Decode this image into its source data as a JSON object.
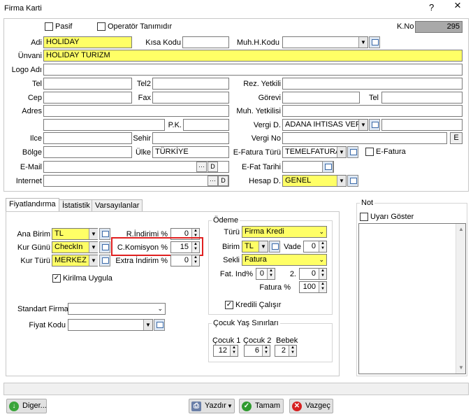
{
  "window": {
    "title": "Firma Karti",
    "help_icon": "?",
    "close_icon": "×"
  },
  "header": {
    "pasif": "Pasif",
    "operator": "Operatör Tanımıdır",
    "kno_label": "K.No",
    "kno_value": "295"
  },
  "fields": {
    "adi_label": "Adi",
    "adi_value": "HOLIDAY",
    "kisa_kodu_label": "Kısa Kodu",
    "muh_kodu_label": "Muh.H.Kodu",
    "unvani_label": "Ünvani",
    "unvani_value": "HOLIDAY TURIZM",
    "logo_label": "Logo Adı",
    "tel_label": "Tel",
    "tel2_label": "Tel2",
    "rez_yetkili_label": "Rez. Yetkili",
    "cep_label": "Cep",
    "fax_label": "Fax",
    "gorevi_label": "Görevi",
    "tel3_label": "Tel",
    "adres_label": "Adres",
    "muh_yetkilisi_label": "Muh. Yetkilisi",
    "pk_label": "P.K.",
    "vergi_d_label": "Vergi D.",
    "vergi_d_value": "ADANA IHTISAS VERG",
    "ilce_label": "Ilce",
    "sehir_label": "Sehir",
    "vergi_no_label": "Vergi No",
    "e_button": "E",
    "bolge_label": "Bölge",
    "ulke_label": "Ülke",
    "ulke_value": "TÜRKİYE",
    "efatura_turu_label": "E-Fatura Türü",
    "efatura_turu_value": "TEMELFATURA",
    "efatura_label": "E-Fatura",
    "email_label": "E-Mail",
    "dots": "···",
    "d_button": "D",
    "efat_tarihi_label": "E-Fat Tarihi",
    "internet_label": "Internet",
    "hesap_label": "Hesap D.",
    "hesap_value": "GENEL"
  },
  "tabs": [
    {
      "label": "Fiyatlandırma"
    },
    {
      "label": "İstatistik"
    },
    {
      "label": "Varsayılanlar"
    }
  ],
  "pricing": {
    "ana_birim_label": "Ana Birim",
    "ana_birim_value": "TL",
    "kur_gunu_label": "Kur Günü",
    "kur_gunu_value": "CheckIn",
    "kur_turu_label": "Kur Türü",
    "kur_turu_value": "MERKEZ",
    "r_indirimi_label": "R.İndirimi %",
    "r_indirimi_value": "0",
    "c_komisyon_label": "C.Komisyon %",
    "c_komisyon_value": "15",
    "extra_indirim_label": "Extra İndirim %",
    "extra_indirim_value": "0",
    "kirilma_label": "Kirilma Uygula",
    "standart_firma_label": "Standart Firma",
    "fiyat_kodu_label": "Fiyat Kodu"
  },
  "odeme": {
    "title": "Ödeme",
    "turu_label": "Türü",
    "turu_value": "Firma Kredi",
    "birim_label": "Birim",
    "birim_value": "TL",
    "vade_label": "Vade",
    "vade_value": "0",
    "sekli_label": "Sekli",
    "sekli_value": "Fatura",
    "fat_ind_label": "Fat. Ind%",
    "fat_ind_value": "0",
    "two_label": "2.",
    "two_value": "0",
    "fatura_pct_label": "Fatura %",
    "fatura_pct_value": "100",
    "kredili_label": "Kredili Çalışır"
  },
  "cocuk": {
    "title": "Çocuk Yaş Sınırları",
    "cocuk1_label": "Çocuk 1",
    "cocuk1_value": "12",
    "cocuk2_label": "Çocuk 2",
    "cocuk2_value": "6",
    "bebek_label": "Bebek",
    "bebek_value": "2"
  },
  "note": {
    "title": "Not",
    "uyari_label": "Uyarı Göster"
  },
  "footer": {
    "diger": "Diger...",
    "yazdir": "Yazdır",
    "tamam": "Tamam",
    "vazgec": "Vazgeç"
  },
  "colors": {
    "highlight": "#ffff66",
    "red_outline": "#e02020",
    "window_bg": "#ffffff"
  }
}
